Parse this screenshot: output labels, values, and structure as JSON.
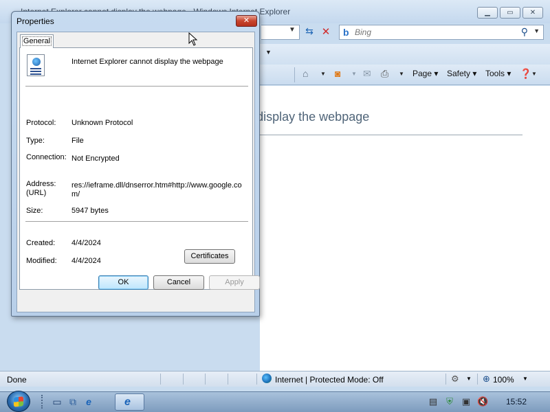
{
  "ie": {
    "title": "Internet Explorer cannot display the webpage - Windows Internet Explorer",
    "search_placeholder": "Bing",
    "search_brand": "b",
    "commands": {
      "page": "Page",
      "safety": "Safety",
      "tools": "Tools"
    },
    "content_heading": "Internet Explorer cannot display the webpage",
    "status": "Done",
    "zone": "Internet | Protected Mode: Off",
    "zoom": "100%"
  },
  "dialog": {
    "title": "Properties",
    "tab": "General",
    "file_name": "Internet Explorer cannot display the webpage",
    "fields": {
      "protocol_label": "Protocol:",
      "protocol_value": "Unknown Protocol",
      "type_label": "Type:",
      "type_value": "File",
      "connection_label": "Connection:",
      "connection_value": "Not Encrypted",
      "address_label": "Address:",
      "address_label2": "(URL)",
      "address_value": "res://ieframe.dll/dnserror.htm#http://www.google.com/",
      "size_label": "Size:",
      "size_value": "5947 bytes",
      "created_label": "Created:",
      "created_value": "4/4/2024",
      "modified_label": "Modified:",
      "modified_value": "4/4/2024"
    },
    "buttons": {
      "certificates": "Certificates",
      "ok": "OK",
      "cancel": "Cancel",
      "apply": "Apply"
    }
  },
  "taskbar": {
    "clock": "15:52"
  },
  "icons": {
    "close": "close-icon",
    "minimize": "minimize-icon",
    "maximize": "maximize-icon",
    "refresh": "refresh-icon",
    "stop": "stop-icon",
    "search": "search-icon",
    "home": "home-icon",
    "feeds": "rss-icon",
    "mail": "mail-icon",
    "print": "printer-icon",
    "help": "help-icon",
    "globe": "globe-icon",
    "ie": "internet-explorer-icon"
  },
  "colors": {
    "accent": "#1c64b4",
    "close_red": "#c8442d"
  }
}
